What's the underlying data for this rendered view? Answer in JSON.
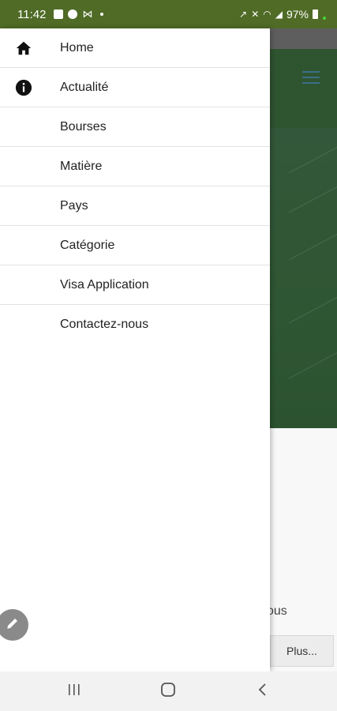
{
  "status_bar": {
    "time": "11:42",
    "battery_text": "97%",
    "icons": [
      "image-icon",
      "facebook-icon",
      "gmail-icon",
      "notification-dot-icon",
      "data-saver-icon",
      "mute-icon",
      "wifi-icon",
      "signal-icon",
      "battery-icon"
    ]
  },
  "drawer": {
    "items": [
      {
        "label": "Home",
        "icon": "home-icon"
      },
      {
        "label": "Actualité",
        "icon": "info-icon"
      },
      {
        "label": "Bourses",
        "icon": ""
      },
      {
        "label": "Matière",
        "icon": ""
      },
      {
        "label": "Pays",
        "icon": ""
      },
      {
        "label": "Catégorie",
        "icon": ""
      },
      {
        "label": "Visa Application",
        "icon": ""
      },
      {
        "label": "Contactez-nous",
        "icon": ""
      }
    ]
  },
  "background_app": {
    "partial_text": "vous",
    "more_button_label": "Plus...",
    "appbar_color": "#2f5430"
  },
  "fab": {
    "icon": "pencil-icon"
  },
  "nav_bar": {
    "icons": [
      "recents-icon",
      "home-circle-icon",
      "back-icon"
    ]
  },
  "colors": {
    "status_bar": "#4f6b26",
    "drawer_bg": "#ffffff",
    "divider": "#e2e2e2"
  }
}
